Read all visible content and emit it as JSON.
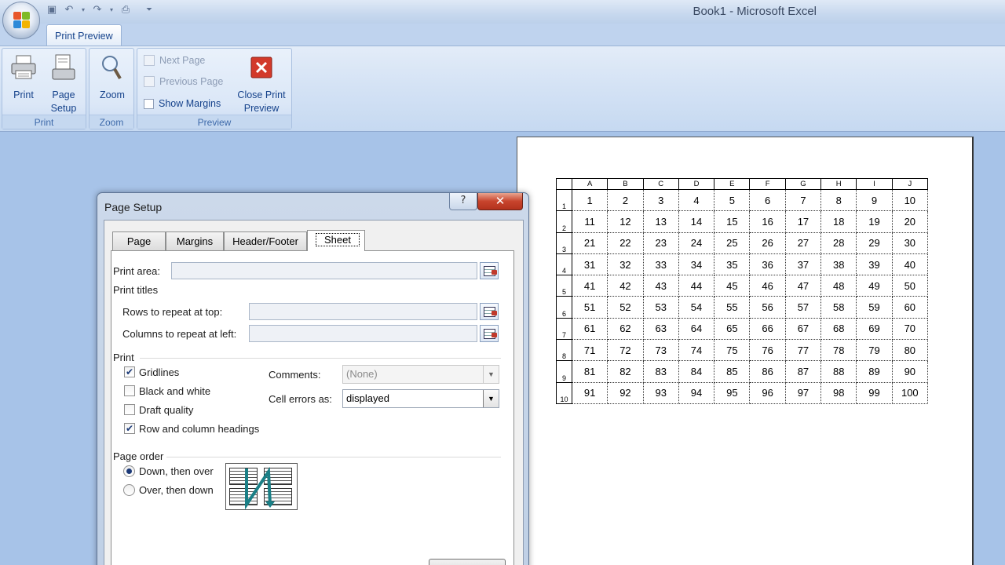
{
  "window": {
    "title": "Book1 - Microsoft Excel"
  },
  "qat": {
    "icons": [
      "save-icon",
      "undo-icon",
      "redo-icon",
      "print-preview-icon",
      "customize-icon"
    ]
  },
  "ribbon": {
    "tab_label": "Print Preview",
    "groups": {
      "print": {
        "label": "Print",
        "print_label": "Print",
        "page_setup_label": "Page Setup"
      },
      "zoom": {
        "label": "Zoom",
        "zoom_label": "Zoom"
      },
      "preview": {
        "label": "Preview",
        "next_page": "Next Page",
        "previous_page": "Previous Page",
        "show_margins": "Show Margins",
        "close_label": "Close Print Preview"
      }
    }
  },
  "sheet": {
    "columns": [
      "A",
      "B",
      "C",
      "D",
      "E",
      "F",
      "G",
      "H",
      "I",
      "J"
    ],
    "rows": [
      {
        "n": "1",
        "cells": [
          "1",
          "2",
          "3",
          "4",
          "5",
          "6",
          "7",
          "8",
          "9",
          "10"
        ]
      },
      {
        "n": "2",
        "cells": [
          "11",
          "12",
          "13",
          "14",
          "15",
          "16",
          "17",
          "18",
          "19",
          "20"
        ]
      },
      {
        "n": "3",
        "cells": [
          "21",
          "22",
          "23",
          "24",
          "25",
          "26",
          "27",
          "28",
          "29",
          "30"
        ]
      },
      {
        "n": "4",
        "cells": [
          "31",
          "32",
          "33",
          "34",
          "35",
          "36",
          "37",
          "38",
          "39",
          "40"
        ]
      },
      {
        "n": "5",
        "cells": [
          "41",
          "42",
          "43",
          "44",
          "45",
          "46",
          "47",
          "48",
          "49",
          "50"
        ]
      },
      {
        "n": "6",
        "cells": [
          "51",
          "52",
          "53",
          "54",
          "55",
          "56",
          "57",
          "58",
          "59",
          "60"
        ]
      },
      {
        "n": "7",
        "cells": [
          "61",
          "62",
          "63",
          "64",
          "65",
          "66",
          "67",
          "68",
          "69",
          "70"
        ]
      },
      {
        "n": "8",
        "cells": [
          "71",
          "72",
          "73",
          "74",
          "75",
          "76",
          "77",
          "78",
          "79",
          "80"
        ]
      },
      {
        "n": "9",
        "cells": [
          "81",
          "82",
          "83",
          "84",
          "85",
          "86",
          "87",
          "88",
          "89",
          "90"
        ]
      },
      {
        "n": "10",
        "cells": [
          "91",
          "92",
          "93",
          "94",
          "95",
          "96",
          "97",
          "98",
          "99",
          "100"
        ]
      }
    ]
  },
  "dialog": {
    "title": "Page Setup",
    "help_label": "?",
    "close_label": "✕",
    "tabs": [
      "Page",
      "Margins",
      "Header/Footer",
      "Sheet"
    ],
    "active_tab": "Sheet",
    "print_area": {
      "label": "Print area:",
      "value": ""
    },
    "print_titles": {
      "heading": "Print titles",
      "rows_label": "Rows to repeat at top:",
      "rows_value": "",
      "cols_label": "Columns to repeat at left:",
      "cols_value": ""
    },
    "print": {
      "heading": "Print",
      "gridlines": {
        "label": "Gridlines",
        "checked": true
      },
      "black_white": {
        "label": "Black and white",
        "checked": false
      },
      "draft": {
        "label": "Draft quality",
        "checked": false
      },
      "headings": {
        "label": "Row and column headings",
        "checked": true
      },
      "comments_label": "Comments:",
      "comments_value": "(None)",
      "errors_label": "Cell errors as:",
      "errors_value": "displayed"
    },
    "page_order": {
      "heading": "Page order",
      "down_then_over": "Down, then over",
      "over_then_down": "Over, then down",
      "selected": "down_then_over"
    }
  }
}
